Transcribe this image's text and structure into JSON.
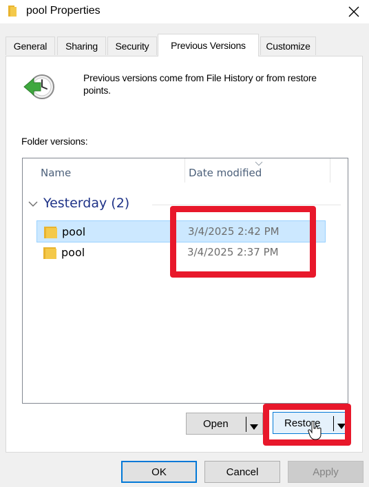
{
  "window": {
    "title": "pool Properties"
  },
  "tabs": [
    {
      "label": "General",
      "active": false
    },
    {
      "label": "Sharing",
      "active": false
    },
    {
      "label": "Security",
      "active": false
    },
    {
      "label": "Previous Versions",
      "active": true
    },
    {
      "label": "Customize",
      "active": false
    }
  ],
  "info": {
    "text": "Previous versions come from File History or from restore points."
  },
  "folder_versions_label": "Folder versions:",
  "list": {
    "columns": {
      "name": "Name",
      "date": "Date modified"
    },
    "group": {
      "label": "Yesterday (2)"
    },
    "rows": [
      {
        "name": "pool",
        "date": "3/4/2025 2:42 PM",
        "selected": true
      },
      {
        "name": "pool",
        "date": "3/4/2025 2:37 PM",
        "selected": false
      }
    ]
  },
  "buttons": {
    "open": "Open",
    "restore": "Restore",
    "ok": "OK",
    "cancel": "Cancel",
    "apply": "Apply"
  },
  "colors": {
    "annotation": "#e8182b",
    "selection": "#cce8ff",
    "group_header": "#1e3287",
    "folder_yellow": "#f4c94a"
  },
  "icons": [
    "folder-icon",
    "close-icon",
    "restore-clock-icon",
    "sort-chevron-icon",
    "group-chevron-icon",
    "dropdown-arrow-icon",
    "mouse-cursor-icon"
  ]
}
